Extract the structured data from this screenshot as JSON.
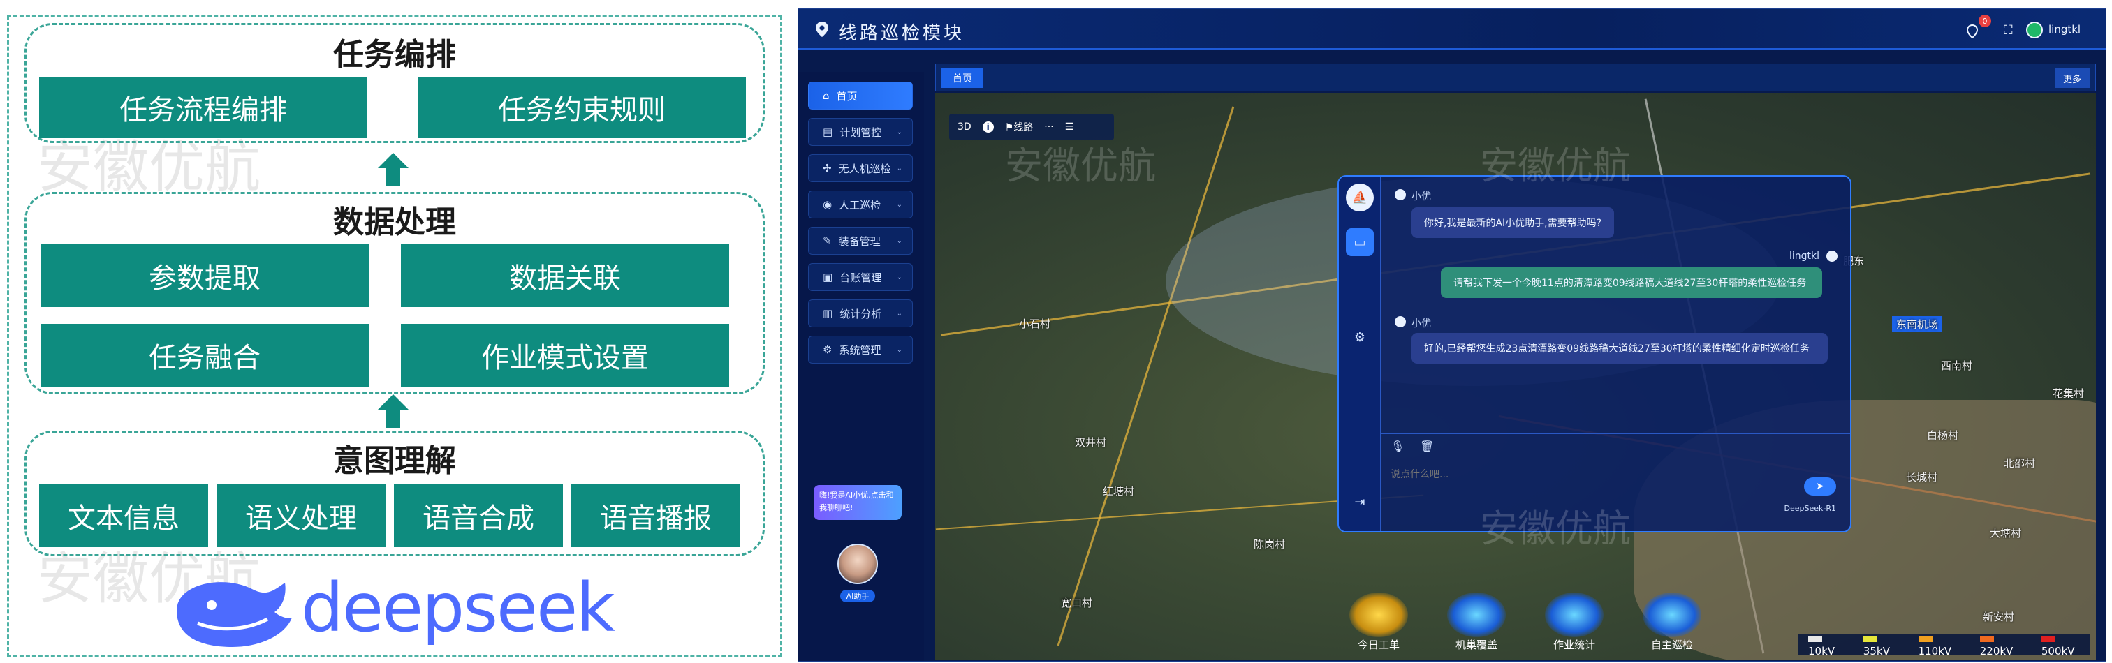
{
  "diagram": {
    "sections": [
      {
        "title": "任务编排",
        "boxes": [
          "任务流程编排",
          "任务约束规则"
        ]
      },
      {
        "title": "数据处理",
        "boxes": [
          "参数提取",
          "数据关联",
          "任务融合",
          "作业模式设置"
        ]
      },
      {
        "title": "意图理解",
        "boxes": [
          "文本信息",
          "语义处理",
          "语音合成",
          "语音播报"
        ]
      }
    ],
    "logo_text": "deepseek",
    "watermark": "安徽优航",
    "colors": {
      "box": "#0e8c7f",
      "border": "#3aa597",
      "logo": "#4d6bfe"
    }
  },
  "app": {
    "title": "线路巡检模块",
    "notification_count": "0",
    "username": "lingtkl",
    "tab_home": "首页",
    "more_button": "更多",
    "nav": [
      {
        "label": "首页",
        "icon": "home-icon"
      },
      {
        "label": "计划管控",
        "icon": "calendar-icon"
      },
      {
        "label": "无人机巡检",
        "icon": "drone-icon"
      },
      {
        "label": "人工巡检",
        "icon": "person-icon"
      },
      {
        "label": "装备管理",
        "icon": "tool-icon"
      },
      {
        "label": "台账管理",
        "icon": "ledger-icon"
      },
      {
        "label": "统计分析",
        "icon": "chart-icon"
      },
      {
        "label": "系统管理",
        "icon": "gear-icon"
      }
    ],
    "assistant_tip": "嗨!我是AI小优,点击和我聊聊吧!",
    "assistant_label": "AI助手",
    "map_toolbar": {
      "mode_3d": "3D",
      "route": "线路",
      "more": "···"
    },
    "map_labels": [
      "陈岗村",
      "红塘村",
      "双井村",
      "白杨村",
      "长城村",
      "北邵村",
      "花集村",
      "大塘村",
      "小石村",
      "西南村",
      "东南机场",
      "肥东",
      "宽口村",
      "新安村"
    ],
    "chat": {
      "bot_name": "小优",
      "user_name": "lingtkl",
      "messages": [
        {
          "from": "bot",
          "text": "你好,我是最新的AI小优助手,需要帮助吗?"
        },
        {
          "from": "user",
          "text": "请帮我下发一个今晚11点的清潭路变09线路稿大道线27至30杆塔的柔性巡检任务"
        },
        {
          "from": "bot",
          "text": "好的,已经帮您生成23点清潭路变09线路稿大道线27至30杆塔的柔性精细化定时巡检任务"
        }
      ],
      "input_placeholder": "说点什么吧...",
      "model": "DeepSeek-R1"
    },
    "bottom_nav": [
      "今日工单",
      "机巢覆盖",
      "作业统计",
      "自主巡检"
    ],
    "legend": [
      {
        "label": "10kV",
        "color": "#e8e8e8"
      },
      {
        "label": "35kV",
        "color": "#e6e63a"
      },
      {
        "label": "110kV",
        "color": "#f0a020"
      },
      {
        "label": "220kV",
        "color": "#f06a20"
      },
      {
        "label": "500kV",
        "color": "#e02020"
      }
    ]
  }
}
